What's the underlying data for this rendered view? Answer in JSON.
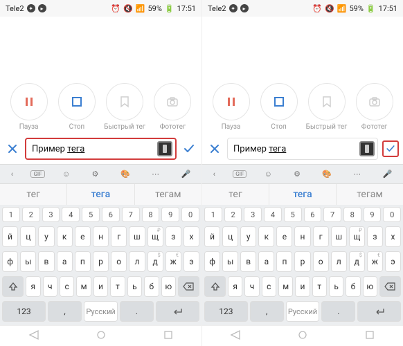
{
  "statusbar": {
    "carrier": "Tele2",
    "battery": "59%",
    "time": "17:51"
  },
  "actions": {
    "pause": "Пауза",
    "stop": "Стоп",
    "quicktag": "Быстрый тег",
    "phototag": "Фототег"
  },
  "input": {
    "prefix": "Пример ",
    "underlined": "тега"
  },
  "suggestions": {
    "s1": "тег",
    "s2": "тега",
    "s3": "тегам"
  },
  "keyboard": {
    "gif_label": "GIF",
    "num_row": [
      "1",
      "2",
      "3",
      "4",
      "5",
      "6",
      "7",
      "8",
      "9",
      "0"
    ],
    "row1": [
      "й",
      "ц",
      "у",
      "к",
      "е",
      "н",
      "г",
      "ш",
      "щ",
      "з",
      "х"
    ],
    "row1_sup": [
      "",
      "",
      "",
      "",
      "",
      "",
      "",
      "",
      "₽",
      "",
      ""
    ],
    "row2": [
      "ф",
      "ы",
      "в",
      "а",
      "п",
      "р",
      "о",
      "л",
      "д",
      "ж",
      "э"
    ],
    "row2_sup": [
      "",
      "",
      "",
      "",
      "",
      "",
      "",
      "",
      "$",
      "€",
      ""
    ],
    "row3": [
      "я",
      "ч",
      "с",
      "м",
      "и",
      "т",
      "ь",
      "б",
      "ю"
    ],
    "k123": "123",
    "lang": "Русский",
    "dot": "."
  },
  "colors": {
    "accent": "#3b7fd1",
    "highlight": "#d23c3c",
    "pause": "#e36a5a",
    "stop": "#3b7fd1",
    "muted": "#cfcfcf"
  }
}
